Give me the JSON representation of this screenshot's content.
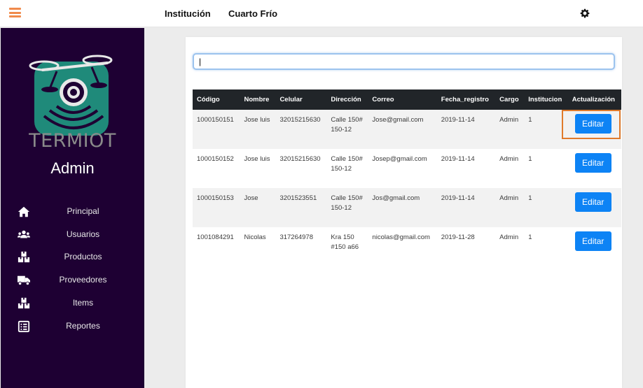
{
  "header": {
    "nav_institucion": "Institución",
    "nav_cuarto_frio": "Cuarto Frío"
  },
  "sidebar": {
    "logo_text": "TERMIOT",
    "role": "Admin",
    "items": [
      {
        "label": "Principal",
        "icon": "home-icon"
      },
      {
        "label": "Usuarios",
        "icon": "users-icon"
      },
      {
        "label": "Productos",
        "icon": "boxes-icon"
      },
      {
        "label": "Proveedores",
        "icon": "truck-icon"
      },
      {
        "label": "Items",
        "icon": "boxes-icon"
      },
      {
        "label": "Reportes",
        "icon": "report-icon"
      }
    ]
  },
  "search": {
    "value": "|",
    "placeholder": ""
  },
  "table": {
    "headers": [
      "Código",
      "Nombre",
      "Celular",
      "Dirección",
      "Correo",
      "Fecha_registro",
      "Cargo",
      "Institucion",
      "Actualización"
    ],
    "rows": [
      {
        "codigo": "1000150151",
        "nombre": "Jose luis",
        "celular": "32015215630",
        "direccion": "Calle 150# 150-12",
        "correo": "Jose@gmail.com",
        "fecha": "2019-11-14",
        "cargo": "Admin",
        "institucion": "1",
        "action": "Editar"
      },
      {
        "codigo": "1000150152",
        "nombre": "Jose luis",
        "celular": "32015215630",
        "direccion": "Calle 150# 150-12",
        "correo": "Josep@gmail.com",
        "fecha": "2019-11-14",
        "cargo": "Admin",
        "institucion": "1",
        "action": "Editar"
      },
      {
        "codigo": "1000150153",
        "nombre": "Jose",
        "celular": "3201523551",
        "direccion": "Calle 150# 150-12",
        "correo": "Jos@gmail.com",
        "fecha": "2019-11-14",
        "cargo": "Admin",
        "institucion": "1",
        "action": "Editar"
      },
      {
        "codigo": "1001084291",
        "nombre": "Nicolas",
        "celular": "317264978",
        "direccion": "Kra 150 #150 a66",
        "correo": "nicolas@gmail.com",
        "fecha": "2019-11-28",
        "cargo": "Admin",
        "institucion": "1",
        "action": "Editar"
      }
    ]
  },
  "colors": {
    "accent": "#f08a4b",
    "sidebar_bg": "#1e0033",
    "button": "#0d83f5",
    "table_header": "#212529",
    "highlight": "#e07a2b"
  }
}
